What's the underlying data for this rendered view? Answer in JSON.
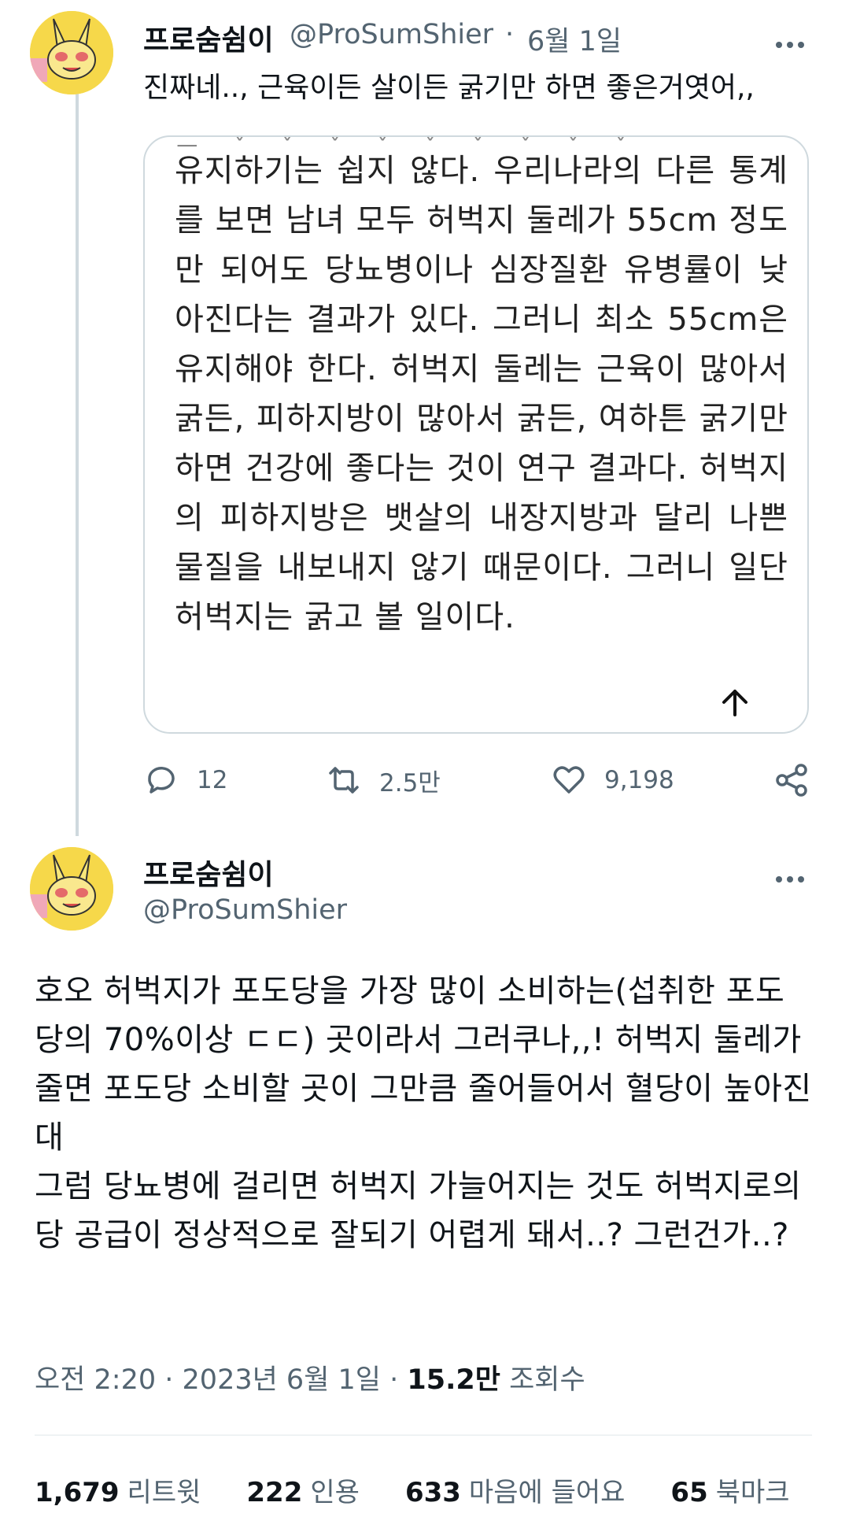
{
  "tweet_reply": {
    "author_name": "프로숨쉼이",
    "handle": "@ProSumShier",
    "date": "6월 1일",
    "dot": "·",
    "text": "진짜네..,  근육이든 살이든 굵기만 하면 좋은거엿어,,",
    "quote_text": "유지하기는 쉽지 않다. 우리나라의 다른 통계를 보면 남녀 모두 허벅지 둘레가 55cm 정도만 되어도 당뇨병이나 심장질환 유병률이 낮아진다는 결과가 있다. 그러니 최소 55cm은 유지해야 한다. 허벅지 둘레는 근육이 많아서 굵든, 피하지방이 많아서 굵든, 여하튼 굵기만 하면 건강에 좋다는 것이 연구 결과다. 허벅지의 피하지방은 뱃살의 내장지방과 달리 나쁜 물질을 내보내지 않기 때문이다. 그러니 일단 허벅지는 굵고 볼 일이다.",
    "replies": "12",
    "retweets": "2.5만",
    "likes": "9,198"
  },
  "tweet_main": {
    "author_name": "프로숨쉼이",
    "handle": "@ProSumShier",
    "text": "호오 허벅지가 포도당을 가장 많이 소비하는(섭취한 포도당의 70%이상 ㄷㄷ) 곳이라서 그러쿠나,,! 허벅지 둘레가 줄면 포도당 소비할 곳이 그만큼 줄어들어서 혈당이 높아진대\n그럼 당뇨병에 걸리면 허벅지 가늘어지는 것도 허벅지로의 당 공급이 정상적으로 잘되기 어렵게 돼서..? 그런건가..?",
    "time": "오전 2:20",
    "date": "2023년 6월 1일",
    "views_count": "15.2만",
    "views_label": "조회수",
    "retweet_count": "1,679",
    "retweet_label": "리트윗",
    "quote_count": "222",
    "quote_label": "인용",
    "like_count": "633",
    "like_label": "마음에 들어요",
    "bookmark_count": "65",
    "bookmark_label": "북마크"
  },
  "icons": {
    "reply": "reply-icon",
    "retweet": "retweet-icon",
    "like": "heart-icon",
    "share": "share-icon",
    "more": "more-icon",
    "scroll_up": "arrow-up-icon"
  },
  "colors": {
    "text": "#0f1419",
    "secondary": "#536471",
    "border": "#cfd9de",
    "avatar_bg": "#f6d84a"
  }
}
